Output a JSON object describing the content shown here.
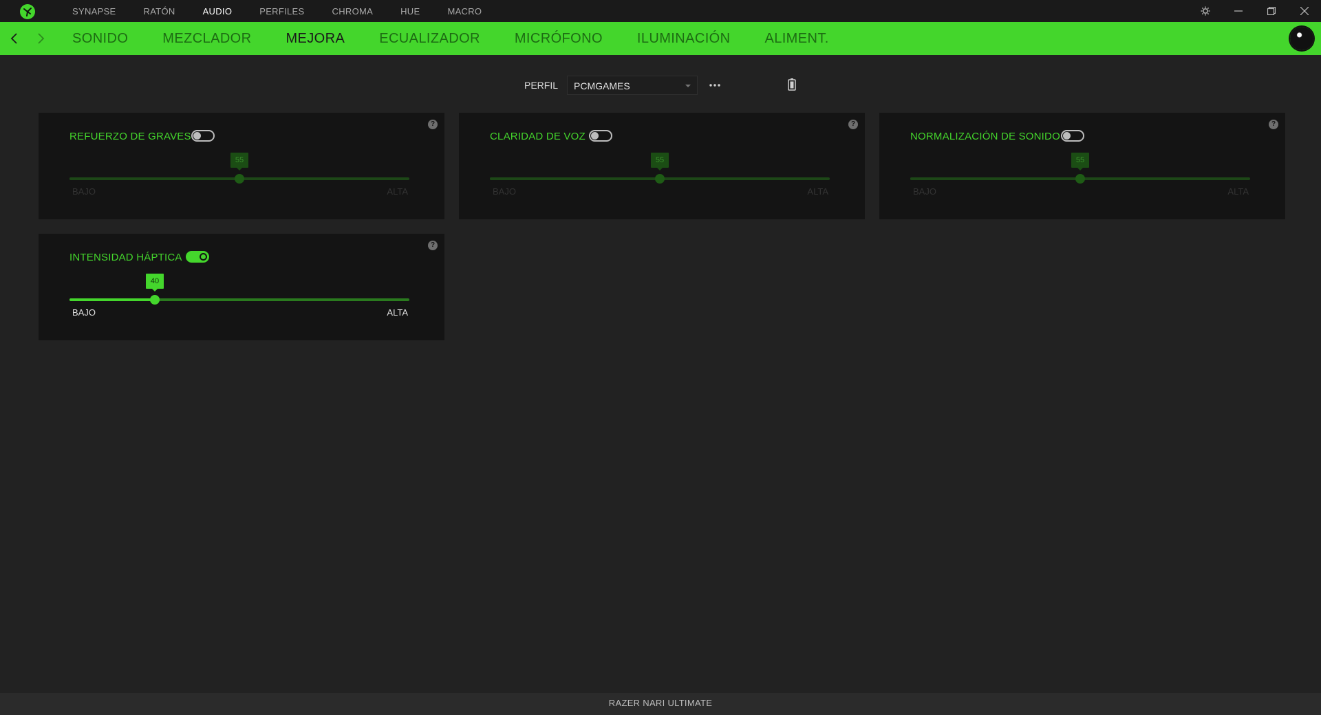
{
  "topnav": {
    "items": [
      {
        "label": "SYNAPSE",
        "active": false
      },
      {
        "label": "RATÓN",
        "active": false
      },
      {
        "label": "AUDIO",
        "active": true
      },
      {
        "label": "PERFILES",
        "active": false
      },
      {
        "label": "CHROMA",
        "active": false
      },
      {
        "label": "HUE",
        "active": false
      },
      {
        "label": "MACRO",
        "active": false
      }
    ]
  },
  "subnav": {
    "tabs": [
      {
        "label": "SONIDO",
        "active": false
      },
      {
        "label": "MEZCLADOR",
        "active": false
      },
      {
        "label": "MEJORA",
        "active": true
      },
      {
        "label": "ECUALIZADOR",
        "active": false
      },
      {
        "label": "MICRÓFONO",
        "active": false
      },
      {
        "label": "ILUMINACIÓN",
        "active": false
      },
      {
        "label": "ALIMENT.",
        "active": false
      }
    ]
  },
  "profile": {
    "label": "PERFIL",
    "selected": "PCMGAMES"
  },
  "cards": [
    {
      "title": "REFUERZO DE GRAVES",
      "enabled": false,
      "value": "55",
      "fraction": 0.5,
      "low": "BAJO",
      "high": "ALTA"
    },
    {
      "title": "CLARIDAD DE VOZ",
      "enabled": false,
      "value": "55",
      "fraction": 0.5,
      "low": "BAJO",
      "high": "ALTA"
    },
    {
      "title": "NORMALIZACIÓN DE SONIDO",
      "enabled": false,
      "value": "55",
      "fraction": 0.5,
      "low": "BAJO",
      "high": "ALTA"
    },
    {
      "title": "INTENSIDAD HÁPTICA",
      "enabled": true,
      "value": "40",
      "fraction": 0.25,
      "low": "BAJO",
      "high": "ALTA"
    }
  ],
  "footer": {
    "device_name": "RAZER NARI ULTIMATE"
  },
  "colors": {
    "accent": "#44d62c",
    "background": "#222222",
    "card": "#141414"
  },
  "icons": [
    "razer-logo-icon",
    "settings-icon",
    "minimize-icon",
    "maximize-icon",
    "close-icon",
    "back-arrow-icon",
    "forward-arrow-icon",
    "more-options-icon",
    "battery-icon",
    "help-icon"
  ]
}
